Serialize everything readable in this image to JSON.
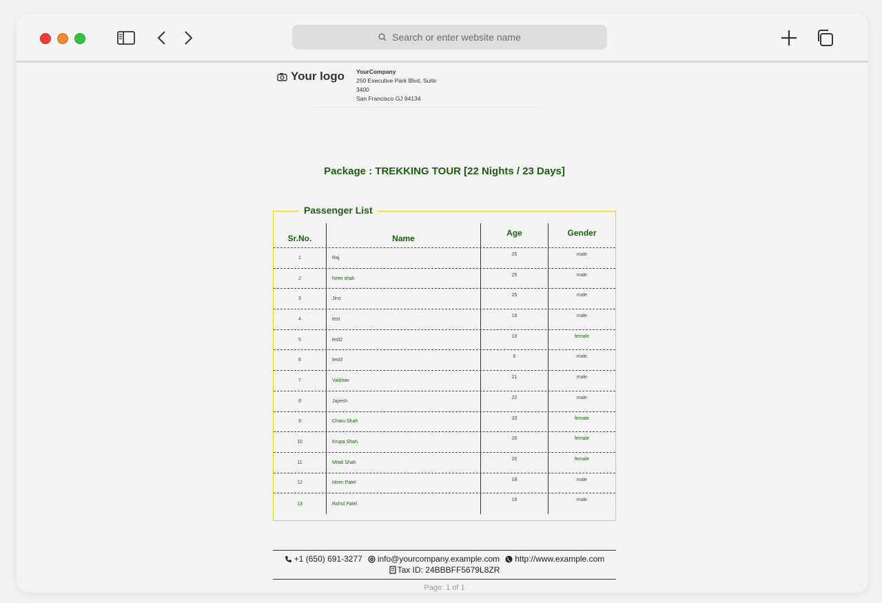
{
  "browser": {
    "address_placeholder": "Search or enter website name",
    "icons": [
      "sidebar-icon",
      "back-icon",
      "forward-icon",
      "search-icon",
      "new-tab-icon",
      "tabs-overview-icon"
    ]
  },
  "header": {
    "logo_text": "Your logo",
    "company_name": "YourCompany",
    "address_line1": "250 Executive Park Blvd, Suite",
    "address_line2": "3400",
    "address_line3": "San Francisco GJ 94134"
  },
  "package": {
    "title": "Package : TREKKING TOUR [22 Nights / 23 Days]"
  },
  "passengers": {
    "legend": "Passenger List",
    "columns": [
      "Sr.No.",
      "Name",
      "Age",
      "Gender"
    ],
    "rows": [
      [
        "1",
        "Raj",
        "25",
        "male"
      ],
      [
        "2",
        "hiren shah",
        "25",
        "male"
      ],
      [
        "3",
        "Jino",
        "25",
        "male"
      ],
      [
        "4",
        "test",
        "18",
        "male"
      ],
      [
        "5",
        "test2",
        "19",
        "female"
      ],
      [
        "6",
        "test3",
        "8",
        "male"
      ],
      [
        "7",
        "Vaibhav",
        "21",
        "male"
      ],
      [
        "8",
        "Jayesh",
        "22",
        "male"
      ],
      [
        "9",
        "Charu Shah",
        "20",
        "female"
      ],
      [
        "10",
        "Krupa Shah",
        "20",
        "female"
      ],
      [
        "11",
        "Mitali Shah",
        "20",
        "female"
      ],
      [
        "12",
        "Hiren Patel",
        "18",
        "male"
      ],
      [
        "13",
        "Rahul Patel",
        "18",
        "male"
      ]
    ]
  },
  "footer": {
    "phone": "+1 (650) 691-3277",
    "email": "info@yourcompany.example.com",
    "website": "http://www.example.com",
    "tax": "Tax ID: 24BBBFF5679L8ZR",
    "page": "Page: 1 of 1"
  },
  "colors": {
    "accent_green": "#1f5d14",
    "fieldset_border": "#e6d12a"
  }
}
